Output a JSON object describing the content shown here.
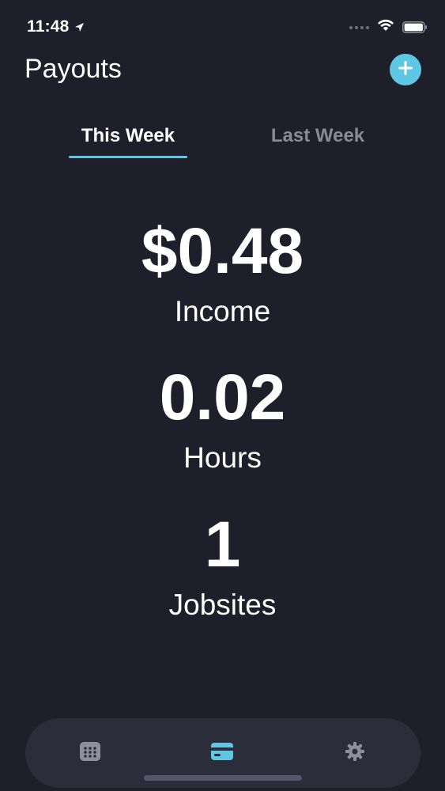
{
  "status_bar": {
    "time": "11:48",
    "icons": [
      "location-arrow-icon",
      "signal-dots-icon",
      "wifi-icon",
      "battery-icon"
    ]
  },
  "header": {
    "title": "Payouts",
    "add_icon": "plus-circle-icon"
  },
  "tabs": [
    {
      "label": "This Week",
      "active": true
    },
    {
      "label": "Last Week",
      "active": false
    }
  ],
  "stats": {
    "income": {
      "value": "$0.48",
      "label": "Income"
    },
    "hours": {
      "value": "0.02",
      "label": "Hours"
    },
    "jobsites": {
      "value": "1",
      "label": "Jobsites"
    }
  },
  "tab_bar": {
    "items": [
      {
        "icon": "calendar-icon",
        "active": false
      },
      {
        "icon": "card-icon",
        "active": true
      },
      {
        "icon": "gear-icon",
        "active": false
      }
    ]
  },
  "colors": {
    "background": "#1f1f2c",
    "accent": "#5ec7e3",
    "tab_bar": "#2c2d3b",
    "inactive_text": "#8a8a96",
    "inactive_icon": "#8e8f9c"
  }
}
